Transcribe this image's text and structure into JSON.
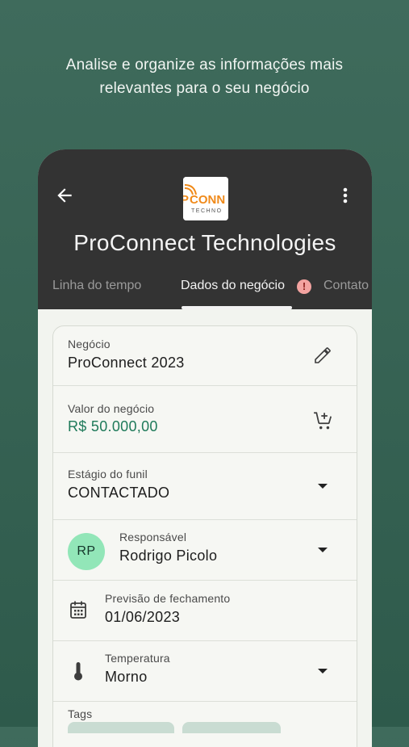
{
  "promo": {
    "line1": "Analise e organize as informações mais",
    "line2": "relevantes para o seu negócio"
  },
  "header": {
    "company_name": "ProConnect Technologies",
    "logo_text_top": "CONN",
    "logo_text_bottom": "TECHNO",
    "logo_prefix": "P"
  },
  "tabs": [
    {
      "label": "Linha do tempo",
      "active": false
    },
    {
      "label": "Dados do negócio",
      "active": true,
      "alert": "!"
    },
    {
      "label": "Contato",
      "active": false
    }
  ],
  "form": {
    "negocio": {
      "label": "Negócio",
      "value": "ProConnect 2023"
    },
    "valor": {
      "label": "Valor do negócio",
      "value": "R$ 50.000,00"
    },
    "estagio": {
      "label": "Estágio do funil",
      "value": "CONTACTADO"
    },
    "responsavel": {
      "label": "Responsável",
      "value": "Rodrigo Picolo",
      "initials": "RP"
    },
    "previsao": {
      "label": "Previsão de fechamento",
      "value": "01/06/2023"
    },
    "temperatura": {
      "label": "Temperatura",
      "value": "Morno"
    },
    "tags": {
      "label": "Tags"
    }
  },
  "colors": {
    "background": "#3f6b5c",
    "appbar": "#333333",
    "accent_green": "#1f7a5a",
    "avatar": "#92e6b8",
    "alert_badge": "#f3a3a0"
  }
}
